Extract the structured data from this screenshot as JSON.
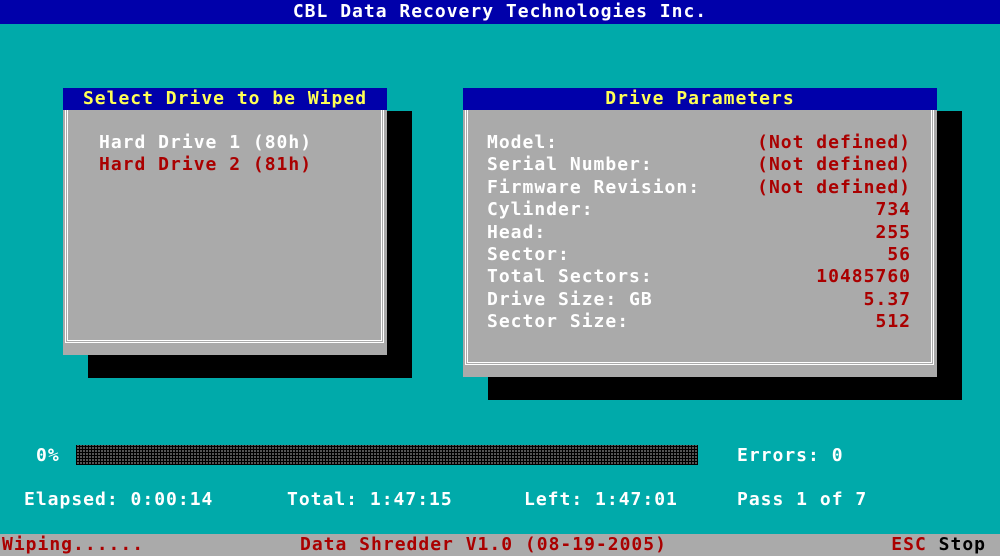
{
  "app": {
    "title": "CBL Data Recovery Technologies Inc."
  },
  "drive_select": {
    "header": "Select Drive to be Wiped",
    "drives": [
      {
        "label": "Hard Drive 1 (80h)",
        "color": "#ffffff"
      },
      {
        "label": "Hard Drive 2 (81h)",
        "color": "#aa0000"
      }
    ]
  },
  "drive_params": {
    "header": "Drive Parameters",
    "rows": [
      {
        "label": "Model:",
        "value": "(Not defined)"
      },
      {
        "label": "Serial Number:",
        "value": "(Not defined)"
      },
      {
        "label": "Firmware Revision:",
        "value": "(Not defined)"
      },
      {
        "label": "Cylinder:",
        "value": "734"
      },
      {
        "label": "Head:",
        "value": "255"
      },
      {
        "label": "Sector:",
        "value": "56"
      },
      {
        "label": "Total Sectors:",
        "value": "10485760"
      },
      {
        "label": "Drive Size: GB",
        "value": "5.37"
      },
      {
        "label": "Sector Size:",
        "value": "512"
      }
    ]
  },
  "progress": {
    "percent_label": "0%",
    "fraction": 0,
    "errors": "Errors: 0",
    "elapsed": "Elapsed: 0:00:14",
    "total": "Total: 1:47:15",
    "left": "Left: 1:47:01",
    "pass": "Pass 1 of 7"
  },
  "statusbar": {
    "status": "Wiping......",
    "version": "Data Shredder V1.0 (08-19-2005)",
    "key": "ESC",
    "action": "Stop"
  },
  "colors": {
    "background": "#00aaaa",
    "title_bg": "#0000aa",
    "panel_bg": "#aaaaaa",
    "header_text": "#ffff55",
    "value_text": "#aa0000"
  }
}
